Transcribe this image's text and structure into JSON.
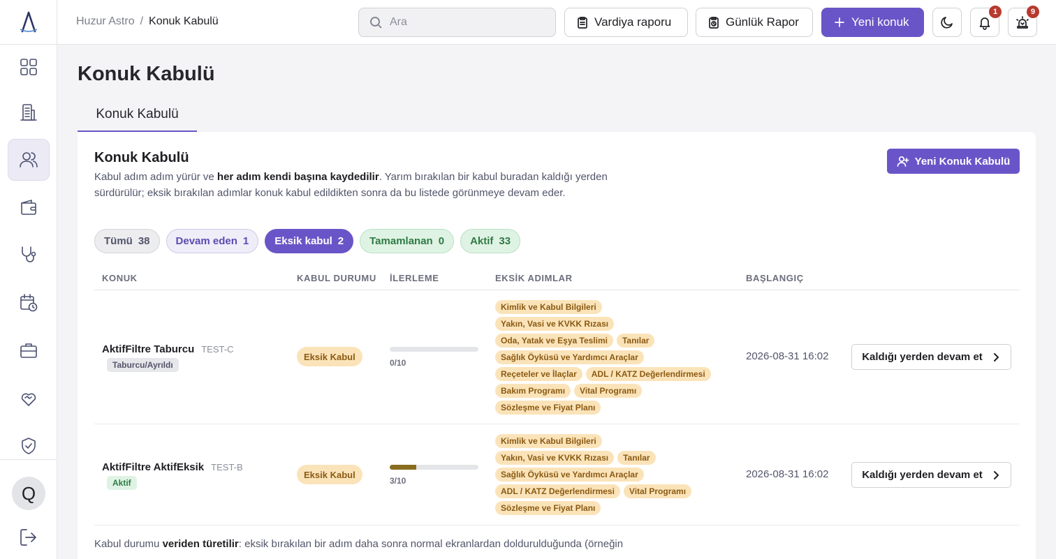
{
  "colors": {
    "accent": "#6a55c8",
    "warning_bg": "#fbe3b9",
    "warning_text": "#8a5a12",
    "success_bg": "#dff3e4",
    "badge": "#b8392e"
  },
  "sidebar": {
    "items": [
      {
        "icon": "dashboard-icon",
        "active": false
      },
      {
        "icon": "building-icon",
        "active": false
      },
      {
        "icon": "users-icon",
        "active": true
      },
      {
        "icon": "wallet-icon",
        "active": false
      },
      {
        "icon": "stethoscope-icon",
        "active": false
      },
      {
        "icon": "calendar-clock-icon",
        "active": false
      },
      {
        "icon": "briefcase-icon",
        "active": false
      },
      {
        "icon": "heart-handshake-icon",
        "active": false
      },
      {
        "icon": "shield-check-icon",
        "active": false
      }
    ],
    "avatar_initial": "Q"
  },
  "topbar": {
    "breadcrumb_root": "Huzur Astro",
    "breadcrumb_sep": "/",
    "breadcrumb_current": "Konuk Kabulü",
    "search_placeholder": "Ara",
    "shift_report": "Vardiya raporu",
    "daily_report": "Günlük Rapor",
    "new_guest": "Yeni konuk",
    "notifications_count": "1",
    "alarms_count": "9"
  },
  "page": {
    "title": "Konuk Kabulü",
    "tab": "Konuk Kabulü"
  },
  "card": {
    "title": "Konuk Kabulü",
    "desc_pre": "Kabul adım adım yürür ve ",
    "desc_bold": "her adım kendi başına kaydedilir",
    "desc_post": ". Yarım bırakılan bir kabul buradan kaldığı yerden sürdürülür; eksik bırakılan adımlar konuk kabul edildikten sonra da bu listede görünmeye devam eder.",
    "new_button": "Yeni Konuk Kabulü"
  },
  "filters": [
    {
      "label": "Tümü",
      "count": "38"
    },
    {
      "label": "Devam eden",
      "count": "1"
    },
    {
      "label": "Eksik kabul",
      "count": "2"
    },
    {
      "label": "Tamamlanan",
      "count": "0"
    },
    {
      "label": "Aktif",
      "count": "33"
    }
  ],
  "table": {
    "headers": [
      "KONUK",
      "KABUL DURUMU",
      "İLERLEME",
      "EKSİK ADIMLAR",
      "BAŞLANGIÇ"
    ],
    "rows": [
      {
        "name": "AktifFiltre Taburcu",
        "code": "TEST-C",
        "state": "Taburcu/Ayrıldı",
        "status": "Eksik Kabul",
        "progress_label": "0/10",
        "progress": 0.0,
        "steps": [
          "Kimlik ve Kabul Bilgileri",
          "Yakın, Vasi ve KVKK Rızası",
          "Oda, Yatak ve Eşya Teslimi",
          "Tanılar",
          "Sağlık Öyküsü ve Yardımcı Araçlar",
          "Reçeteler ve İlaçlar",
          "ADL / KATZ Değerlendirmesi",
          "Bakım Programı",
          "Vital Programı",
          "Sözleşme ve Fiyat Planı"
        ],
        "start": "2026-08-31 16:02",
        "action": "Kaldığı yerden devam et"
      },
      {
        "name": "AktifFiltre AktifEksik",
        "code": "TEST-B",
        "state": "Aktif",
        "status": "Eksik Kabul",
        "progress_label": "3/10",
        "progress": 0.3,
        "steps": [
          "Kimlik ve Kabul Bilgileri",
          "Yakın, Vasi ve KVKK Rızası",
          "Tanılar",
          "Sağlık Öyküsü ve Yardımcı Araçlar",
          "ADL / KATZ Değerlendirmesi",
          "Vital Programı",
          "Sözleşme ve Fiyat Planı"
        ],
        "start": "2026-08-31 16:02",
        "action": "Kaldığı yerden devam et"
      }
    ]
  },
  "footnote": {
    "pre": "Kabul durumu ",
    "bold": "veriden türetilir",
    "post": ": eksik bırakılan bir adım daha sonra normal ekranlardan doldurulduğunda (örneğin"
  }
}
